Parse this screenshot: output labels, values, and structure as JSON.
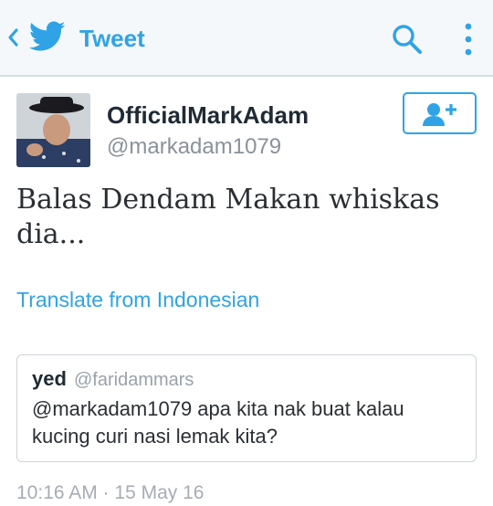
{
  "appbar": {
    "title": "Tweet",
    "back_icon": "chevron-left-icon",
    "logo_icon": "twitter-bird-icon",
    "search_icon": "search-icon",
    "more_icon": "more-vertical-icon",
    "accent_color": "#2fa3e6"
  },
  "tweet": {
    "display_name": "OfficialMarkAdam",
    "handle": "@markadam1079",
    "text": "Balas Dendam Makan whiskas dia...",
    "translate_label": "Translate from Indonesian",
    "follow_icon": "add-user-icon",
    "timestamp": "10:16 AM · 15 May 16"
  },
  "quoted_tweet": {
    "name": "yed",
    "handle": "@faridammars",
    "text": "@markadam1079 apa kita nak buat kalau kucing curi nasi lemak kita?"
  }
}
